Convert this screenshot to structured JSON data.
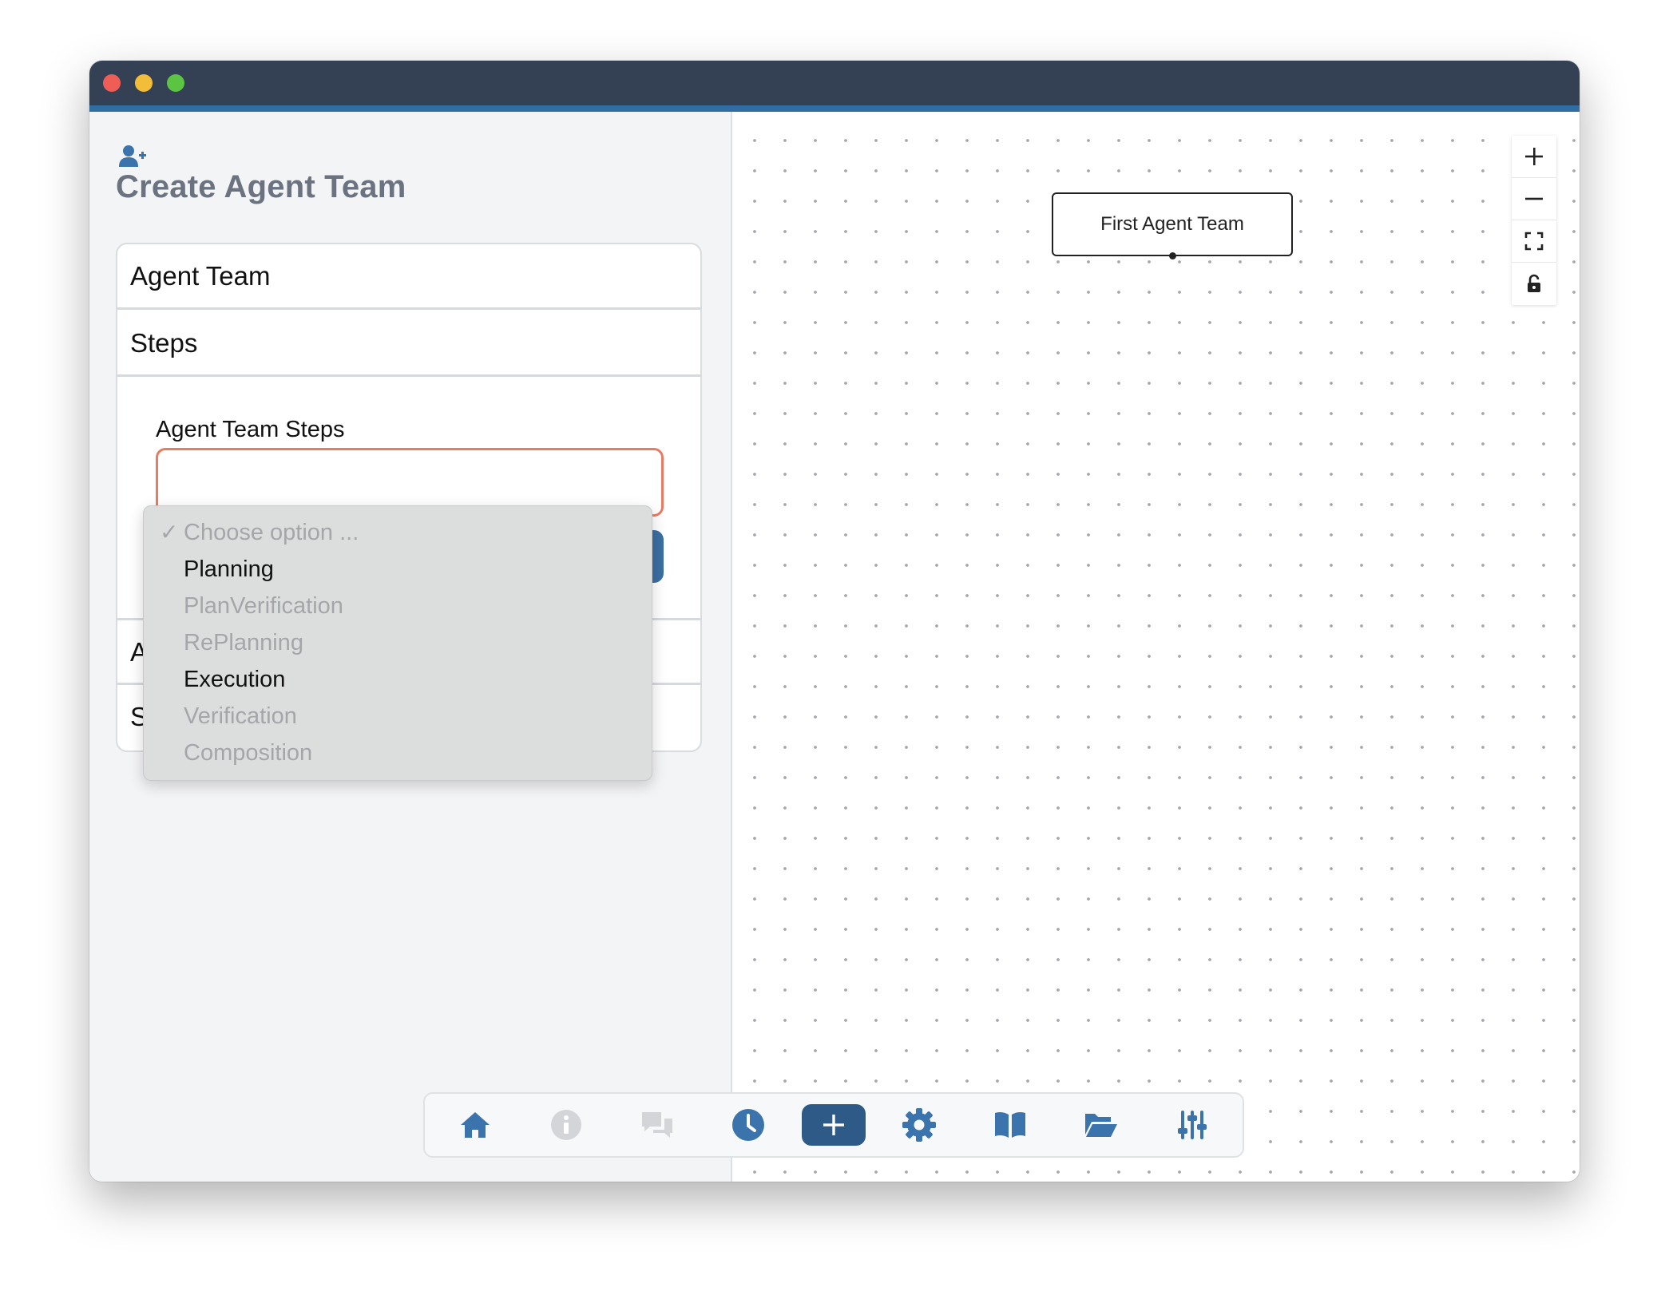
{
  "window": {
    "colors": {
      "titlebar": "#344154",
      "accent": "#2f6da3",
      "primary": "#3b6fa2"
    }
  },
  "left_panel": {
    "title_icon": "user-plus-icon",
    "title": "Create Agent Team",
    "sections": {
      "agent_team": "Agent Team",
      "steps": "Steps",
      "section3_visible": "A",
      "section4_visible": "S"
    },
    "steps_field": {
      "label": "Agent Team Steps",
      "dropdown": {
        "selected": "Choose option ...",
        "options": [
          {
            "label": "Choose option ...",
            "checked": true,
            "disabled": true
          },
          {
            "label": "Planning",
            "disabled": false
          },
          {
            "label": "PlanVerification",
            "disabled": true
          },
          {
            "label": "RePlanning",
            "disabled": true
          },
          {
            "label": "Execution",
            "disabled": false
          },
          {
            "label": "Verification",
            "disabled": true
          },
          {
            "label": "Composition",
            "disabled": true
          }
        ]
      }
    }
  },
  "canvas": {
    "node_label": "First Agent Team",
    "controls": [
      "plus-icon",
      "minus-icon",
      "fit-view-icon",
      "lock-icon"
    ]
  },
  "bottom_bar": {
    "items": [
      {
        "icon": "home-icon",
        "color": "#3b74ad"
      },
      {
        "icon": "info-icon",
        "color": "#d3d5d8"
      },
      {
        "icon": "chat-icon",
        "color": "#d3d5d8"
      },
      {
        "icon": "clock-icon",
        "color": "#3b74ad"
      },
      {
        "icon": "add-icon",
        "color": "#2d5a86"
      },
      {
        "icon": "gear-icon",
        "color": "#3b74ad"
      },
      {
        "icon": "book-icon",
        "color": "#3b74ad"
      },
      {
        "icon": "folder-open-icon",
        "color": "#3b74ad"
      },
      {
        "icon": "sliders-icon",
        "color": "#3b74ad"
      }
    ]
  }
}
